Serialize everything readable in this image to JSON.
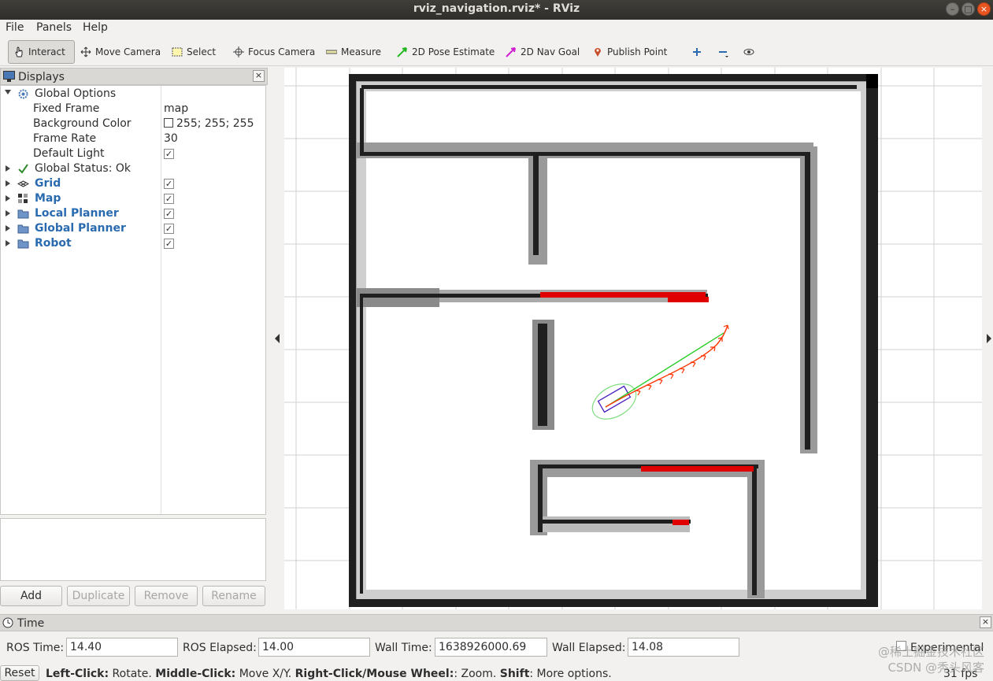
{
  "window": {
    "title": "rviz_navigation.rviz* - RViz"
  },
  "menu": [
    "File",
    "Panels",
    "Help"
  ],
  "toolbar": {
    "interact": "Interact",
    "move_camera": "Move Camera",
    "select": "Select",
    "focus_camera": "Focus Camera",
    "measure": "Measure",
    "pose_estimate": "2D Pose Estimate",
    "nav_goal": "2D Nav Goal",
    "publish_point": "Publish Point"
  },
  "displays": {
    "title": "Displays",
    "global_options": "Global Options",
    "props": [
      {
        "name": "Fixed Frame",
        "value": "map"
      },
      {
        "name": "Background Color",
        "value": "255; 255; 255"
      },
      {
        "name": "Frame Rate",
        "value": "30"
      },
      {
        "name": "Default Light",
        "value": ""
      }
    ],
    "global_status": "Global Status: Ok",
    "items": [
      "Grid",
      "Map",
      "Local Planner",
      "Global Planner",
      "Robot"
    ],
    "buttons": {
      "add": "Add",
      "duplicate": "Duplicate",
      "remove": "Remove",
      "rename": "Rename"
    }
  },
  "time": {
    "title": "Time",
    "ros_time_label": "ROS Time:",
    "ros_time": "14.40",
    "ros_elapsed_label": "ROS Elapsed:",
    "ros_elapsed": "14.00",
    "wall_time_label": "Wall Time:",
    "wall_time": "1638926000.69",
    "wall_elapsed_label": "Wall Elapsed:",
    "wall_elapsed": "14.08",
    "experimental": "Experimental"
  },
  "status": {
    "reset": "Reset",
    "k1": "Left-Click:",
    "v1": " Rotate. ",
    "k2": "Middle-Click:",
    "v2": " Move X/Y. ",
    "k3": "Right-Click/Mouse Wheel:",
    "v3": ": Zoom. ",
    "k4": "Shift",
    "v4": ": More options.",
    "fps": "31 fps"
  },
  "watermark": {
    "line1": "@稀土掘金技术社区",
    "line2": "CSDN @秃头风客"
  },
  "colors": {
    "wall": "#1a1a1a",
    "inflation": "#8c8c8c",
    "obstacle": "#e00000",
    "global_path": "#22cc22",
    "local_path": "#ff3300",
    "footprint": "#4a1fbf"
  }
}
